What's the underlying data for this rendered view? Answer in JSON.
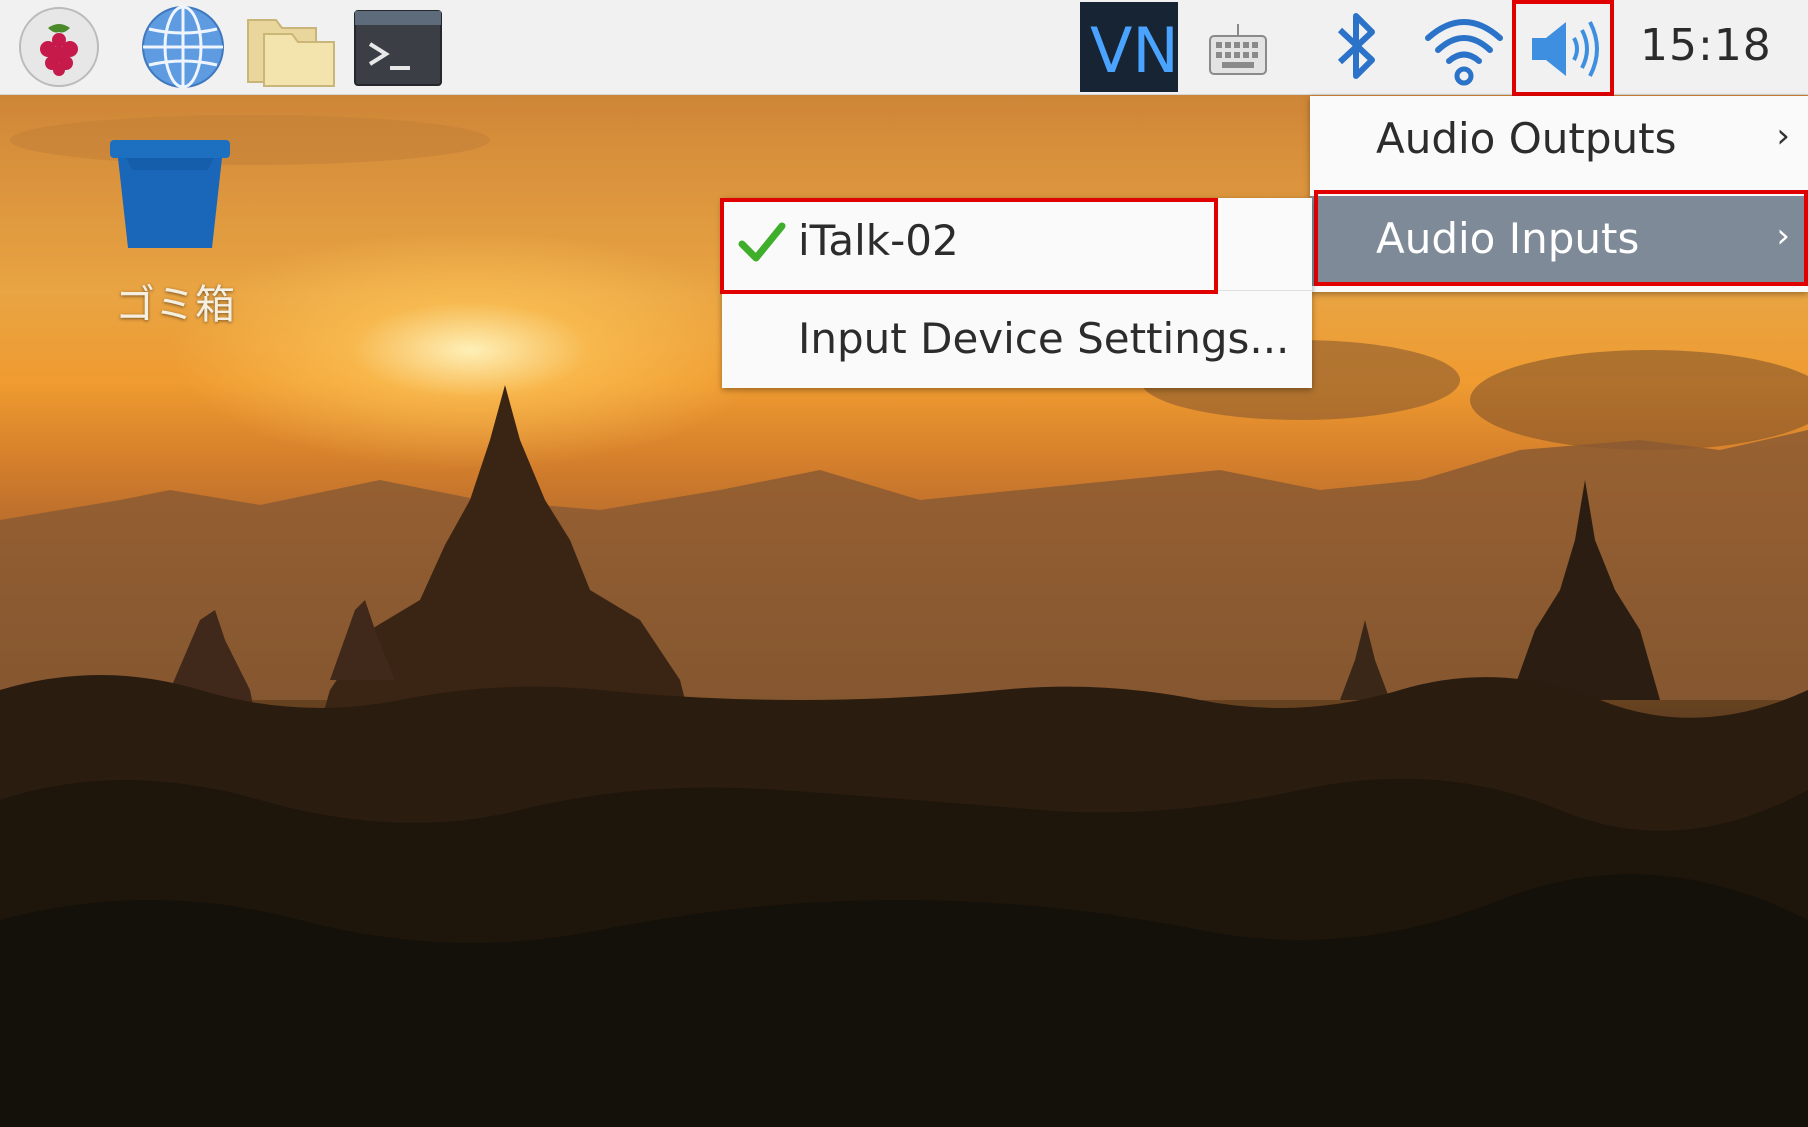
{
  "taskbar": {
    "clock": "15:18",
    "icons": [
      "raspberry-menu-icon",
      "globe-icon",
      "folder-icon",
      "terminal-icon",
      "vnc-icon",
      "keyboard-icon",
      "bluetooth-icon",
      "wifi-icon",
      "volume-icon"
    ],
    "vnc_label": "VNC"
  },
  "desktop": {
    "trash_label": "ゴミ箱"
  },
  "audio_menu": {
    "items": [
      {
        "label": "Audio Outputs"
      },
      {
        "label": "Audio Inputs"
      }
    ]
  },
  "inputs_submenu": {
    "items": [
      {
        "label": "iTalk-02",
        "checked": true
      },
      {
        "label": "Input Device Settings..."
      }
    ]
  },
  "colors": {
    "highlight": "#e00000",
    "menu_selected_bg": "#7f8a99",
    "accent_blue": "#2a73c9"
  }
}
